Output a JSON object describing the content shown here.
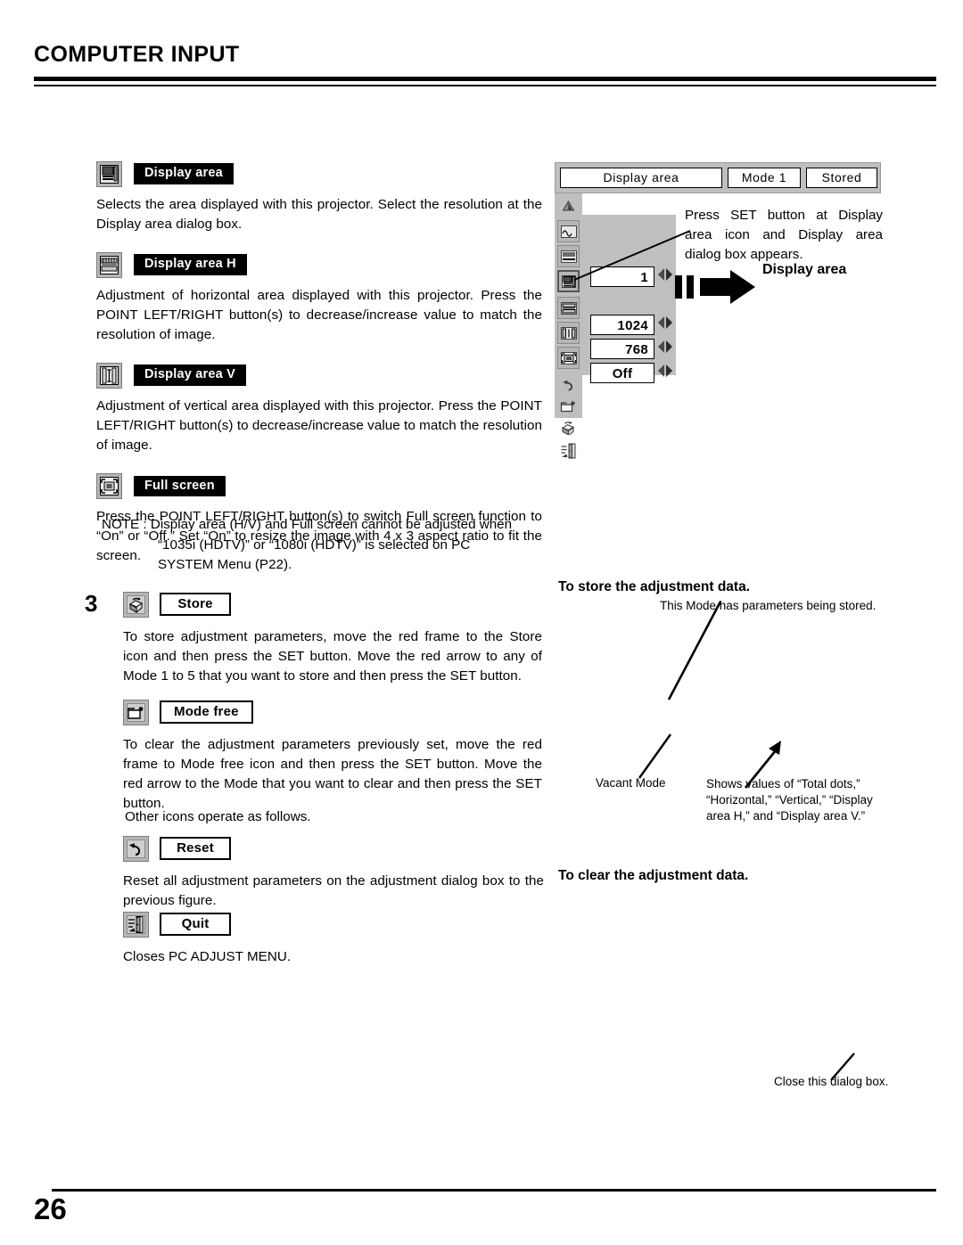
{
  "header": {
    "title": "COMPUTER INPUT"
  },
  "footer": {
    "page_number": "26"
  },
  "left_column": {
    "sections": [
      {
        "icon": "display-area-icon",
        "label": "Display area",
        "label_style": "inverted",
        "body": "Selects the area displayed with this projector.  Select the resolution at the Display area dialog box."
      },
      {
        "icon": "display-area-h-icon",
        "label": "Display area H",
        "label_style": "inverted",
        "body": "Adjustment of horizontal area displayed with this projector.  Press the POINT LEFT/RIGHT button(s) to decrease/increase value to match the resolution of image."
      },
      {
        "icon": "display-area-v-icon",
        "label": "Display area V",
        "label_style": "inverted",
        "body": "Adjustment of vertical area displayed with this projector.  Press the POINT LEFT/RIGHT button(s) to decrease/increase value to match the resolution of image."
      },
      {
        "icon": "full-screen-icon",
        "label": "Full screen",
        "label_style": "inverted",
        "body": "Press the POINT LEFT/RIGHT button(s) to switch Full screen function to  “On” or “Off.”  Set “On” to resize the image with 4 x 3 aspect ratio to fit the screen."
      }
    ],
    "note": {
      "line1": "NOTE : Display area (H/V) and Full screen cannot be adjusted when",
      "line2": "“1035i (HDTV)” or “1080i (HDTV)” is selected on PC",
      "line3": "SYSTEM Menu (P22)."
    },
    "step3": {
      "number": "3",
      "store": {
        "icon": "store-icon",
        "label": "Store",
        "label_style": "outlined",
        "body": "To store adjustment parameters, move the red frame to the Store icon and then press the SET button.  Move the red arrow to any of Mode 1 to 5 that you want to store and then press the SET button."
      },
      "mode_free": {
        "icon": "mode-free-icon",
        "label": "Mode free",
        "label_style": "outlined",
        "body": "To clear the adjustment parameters previously set, move the red frame to Mode free icon and then press the SET button.  Move the red arrow to the Mode that you want to clear and then press the SET button."
      },
      "other_icons_line": "Other icons operate as follows.",
      "reset": {
        "icon": "reset-icon",
        "label": "Reset",
        "label_style": "outlined",
        "body": "Reset all adjustment parameters on the adjustment dialog box to the previous figure."
      },
      "quit": {
        "icon": "quit-icon",
        "label": "Quit",
        "label_style": "outlined",
        "body": "Closes PC ADJUST MENU."
      }
    }
  },
  "right_column": {
    "osd": {
      "topbar": {
        "title": "Display area",
        "mode": "Mode 1",
        "state": "Stored"
      },
      "rail_icons": [
        "scroll-up-icon",
        "fine-sync-icon",
        "total-dots-icon",
        "display-area-icon",
        "display-area-h-icon",
        "display-area-v-icon",
        "full-screen-icon",
        "reset-icon",
        "mode-free-icon",
        "store-icon",
        "quit-icon"
      ],
      "values": [
        {
          "name": "total-dots-value",
          "value": "1"
        },
        {
          "name": "display-area-h-value",
          "value": "1024"
        },
        {
          "name": "display-area-v-value",
          "value": "768"
        },
        {
          "name": "full-screen-value",
          "value": "Off"
        }
      ]
    },
    "osd_note": "Press SET button at Display area icon and Display area dialog box appears.",
    "display_area_caption": "Display area",
    "store_heading": "To store the adjustment data.",
    "store_sub": "This Mode has parameters being stored.",
    "vacant_mode": "Vacant Mode",
    "shows_values": "Shows values of “Total dots,” “Horizontal,” “Vertical,” “Display area H,” and “Display area V.”",
    "clear_heading": "To clear the adjustment data.",
    "close_dialog": "Close this dialog box."
  }
}
